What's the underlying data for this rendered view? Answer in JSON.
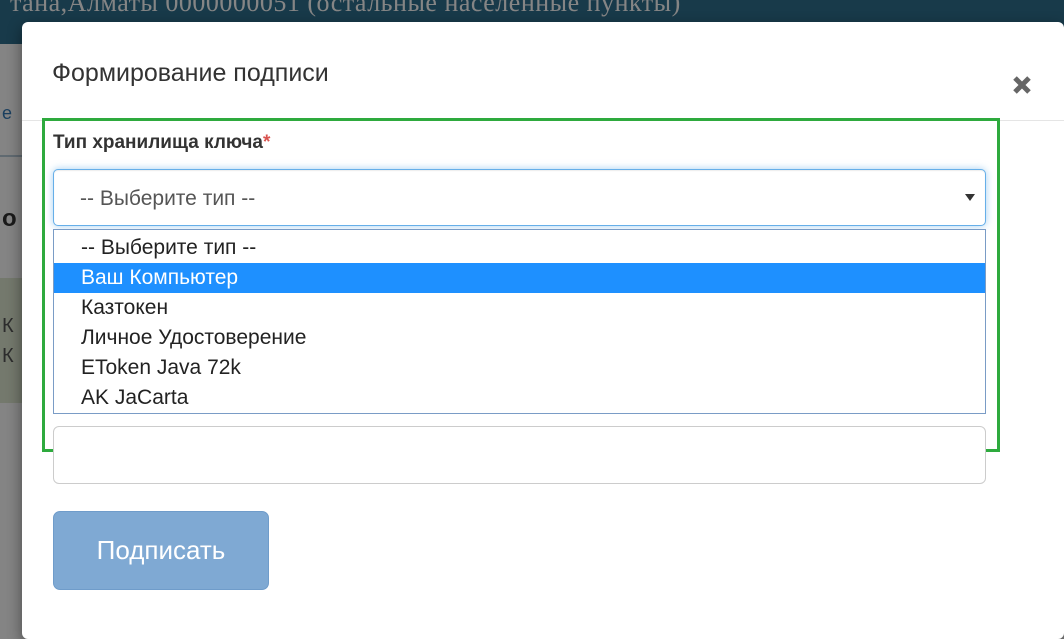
{
  "background": {
    "header_text": "тана,Алматы 0000000051 (остальные населенные пункты)",
    "edge_chars": [
      "е",
      "о",
      "К",
      "К"
    ]
  },
  "modal": {
    "title": "Формирование подписи",
    "close_icon": "close-icon",
    "key_storage": {
      "label": "Тип хранилища ключа",
      "required_mark": "*",
      "selected_value": "-- Выберите тип --",
      "options": [
        {
          "label": "-- Выберите тип --",
          "highlighted": false
        },
        {
          "label": "Ваш Компьютер",
          "highlighted": true
        },
        {
          "label": "Казтокен",
          "highlighted": false
        },
        {
          "label": "Личное Удостоверение",
          "highlighted": false
        },
        {
          "label": "EToken Java 72k",
          "highlighted": false
        },
        {
          "label": "AK JaCarta",
          "highlighted": false
        }
      ]
    },
    "password_field": {
      "value": "",
      "placeholder": ""
    },
    "sign_button_label": "Подписать"
  },
  "colors": {
    "highlight_border": "#2eaa3e",
    "option_highlight": "#1e90ff",
    "button_bg": "#7fa9d3",
    "required": "#d9534f"
  }
}
